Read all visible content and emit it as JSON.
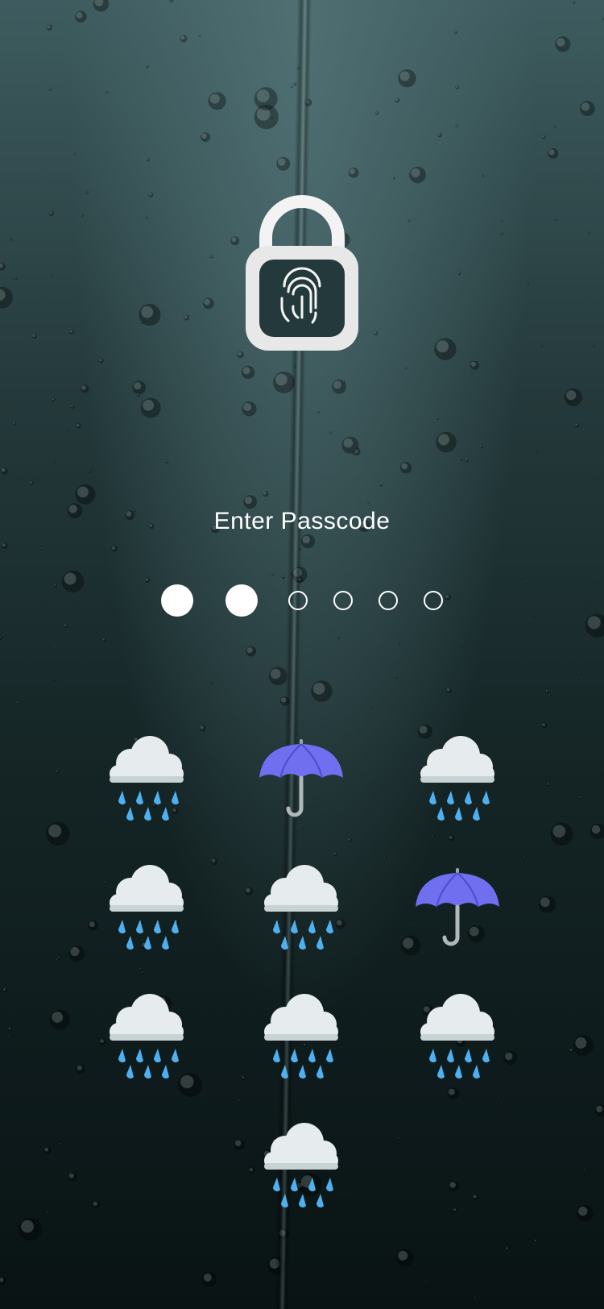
{
  "screen": {
    "title": "Enter Passcode"
  },
  "passcode": {
    "length": 6,
    "entered": 2
  },
  "keypad": {
    "rows": [
      [
        "cloud-rain",
        "umbrella",
        "cloud-rain"
      ],
      [
        "cloud-rain",
        "cloud-rain",
        "umbrella"
      ],
      [
        "cloud-rain",
        "cloud-rain",
        "cloud-rain"
      ],
      [
        "cloud-rain"
      ]
    ]
  },
  "icons": {
    "lock": "fingerprint-lock-icon"
  },
  "colors": {
    "umbrella": "#6f6ff0",
    "cloud": "#e6ecee",
    "raindrop": "#4fb0ef",
    "text": "#ffffff"
  }
}
